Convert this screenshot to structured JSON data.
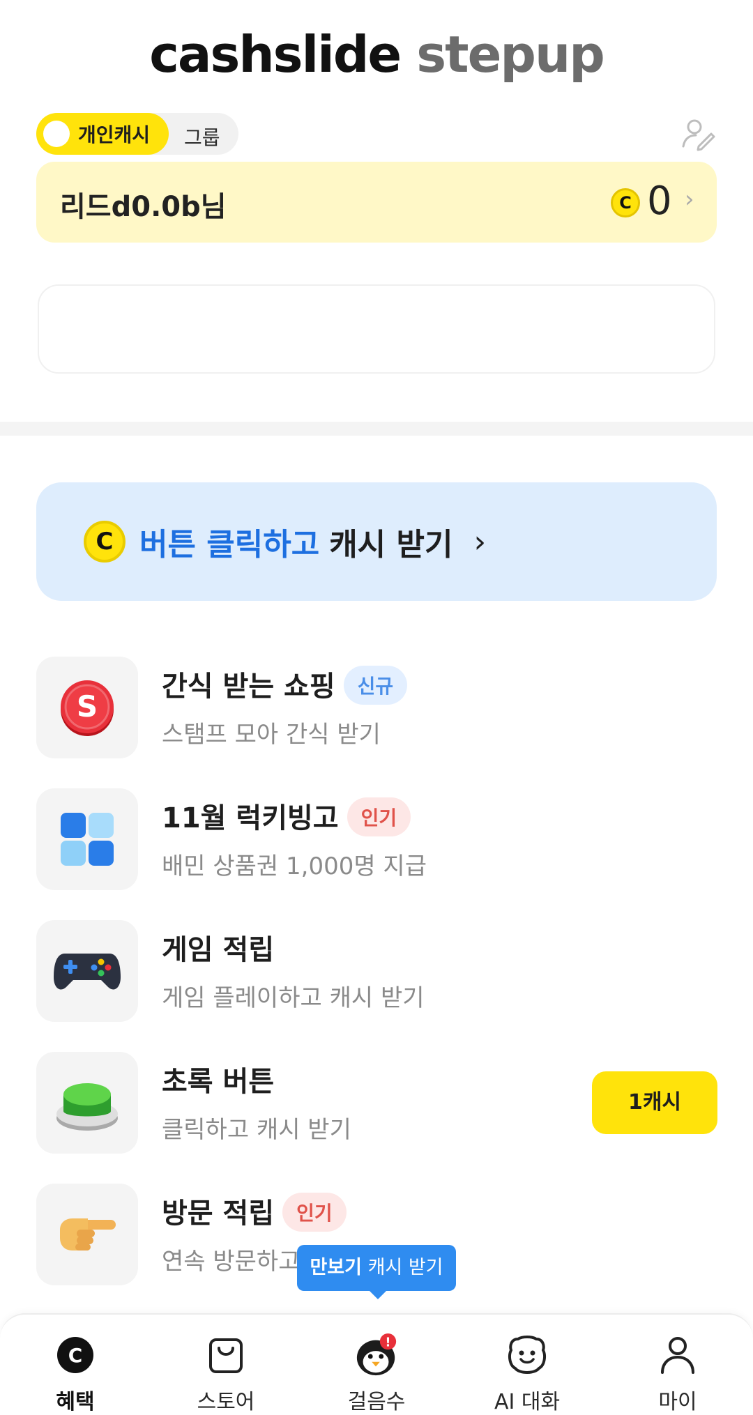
{
  "header": {
    "logo_main": "cashslide",
    "logo_sub": "stepup"
  },
  "toggle": {
    "active": "개인캐시",
    "inactive": "그룹"
  },
  "user": {
    "name": "리드d0.0b님",
    "coin_symbol": "C",
    "balance": "0"
  },
  "banner": {
    "coin_symbol": "C",
    "highlight": "버튼 클릭하고",
    "text": "캐시 받기"
  },
  "items": [
    {
      "title": "간식 받는 쇼핑",
      "badge": "신규",
      "subtitle": "스탬프 모아 간식 받기",
      "icon": "snack-shop-icon"
    },
    {
      "title": "11월 럭키빙고",
      "badge": "인기",
      "subtitle": "배민 상품권 1,000명 지급",
      "icon": "bingo-grid-icon"
    },
    {
      "title": "게임 적립",
      "badge": "",
      "subtitle": "게임 플레이하고 캐시 받기",
      "icon": "gamepad-icon"
    },
    {
      "title": "초록 버튼",
      "badge": "",
      "subtitle": "클릭하고 캐시 받기",
      "icon": "green-button-icon",
      "action": "1캐시"
    },
    {
      "title": "방문 적립",
      "badge": "인기",
      "subtitle": "연속 방문하고",
      "icon": "pointing-hand-icon"
    }
  ],
  "tooltip": {
    "bold": "만보기",
    "text": "캐시 받기"
  },
  "nav": [
    {
      "label": "혜택",
      "icon": "benefit-coin-icon",
      "active": true
    },
    {
      "label": "스토어",
      "icon": "shopping-bag-icon",
      "active": false
    },
    {
      "label": "걸음수",
      "icon": "penguin-icon",
      "active": false,
      "alert": "!"
    },
    {
      "label": "AI 대화",
      "icon": "ai-face-icon",
      "active": false
    },
    {
      "label": "마이",
      "icon": "person-icon",
      "active": false
    }
  ],
  "colors": {
    "accent_yellow": "#ffe30b",
    "blue": "#1d6fe0",
    "badge_red": "#e0524a",
    "badge_blue": "#4a8ee8"
  }
}
